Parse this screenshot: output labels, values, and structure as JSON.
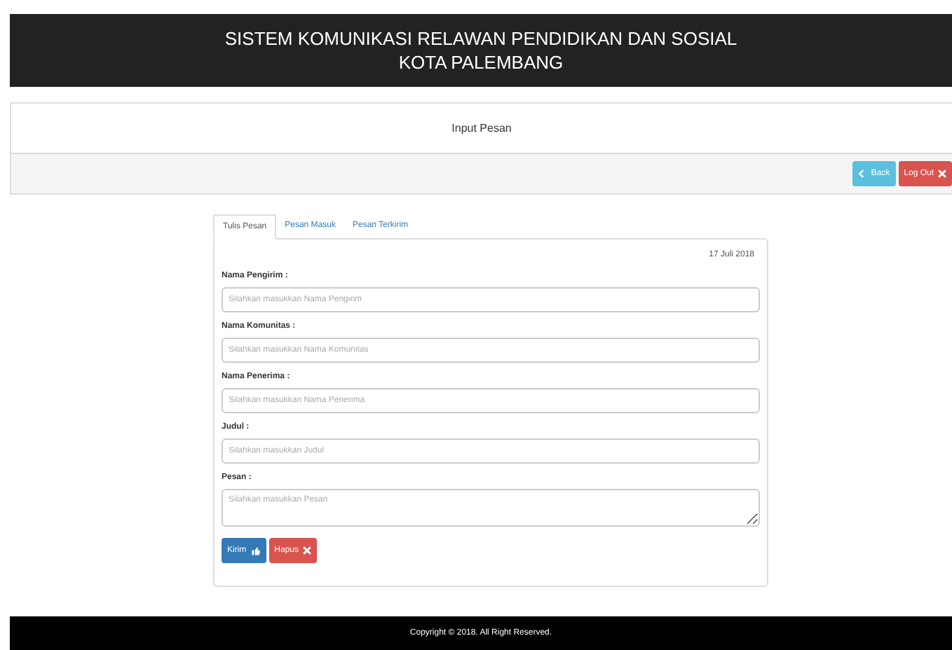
{
  "header": {
    "title_lines": [
      "SISTEM KOMUNIKASI RELAWAN PENDIDIKAN DAN SOSIAL",
      "KOTA PALEMBANG"
    ]
  },
  "panel": {
    "title": "Input Pesan",
    "buttons": [
      {
        "label": "Back",
        "kind": "info"
      },
      {
        "label": "Log Out",
        "kind": "danger"
      }
    ]
  },
  "tabs": [
    {
      "label": "Tulis Pesan",
      "selected": true
    },
    {
      "label": "Pesan Masuk",
      "selected": false
    },
    {
      "label": "Pesan Terkirim",
      "selected": false
    }
  ],
  "form": {
    "date": "17 Juli 2018",
    "fields": [
      {
        "label": "Nama Pengirim :",
        "placeholder": "Silahkan masukkan Nama Pengirim",
        "kind": "input"
      },
      {
        "label": "Nama Komunitas :",
        "placeholder": "Silahkan masukkan Nama Komunitas",
        "kind": "input"
      },
      {
        "label": "Nama Penerima :",
        "placeholder": "Silahkan masukkan Nama Penerima",
        "kind": "input"
      },
      {
        "label": "Judul :",
        "placeholder": "Silahkan masukkan Judul",
        "kind": "input"
      },
      {
        "label": "Pesan :",
        "placeholder": "Silahkan masukkan Pesan",
        "kind": "textarea"
      }
    ],
    "buttons": [
      {
        "label": "Kirim",
        "kind": "primary"
      },
      {
        "label": "Hapus",
        "kind": "danger"
      }
    ]
  },
  "footer": {
    "text": "Copyright © 2018. All Right Reserved."
  }
}
